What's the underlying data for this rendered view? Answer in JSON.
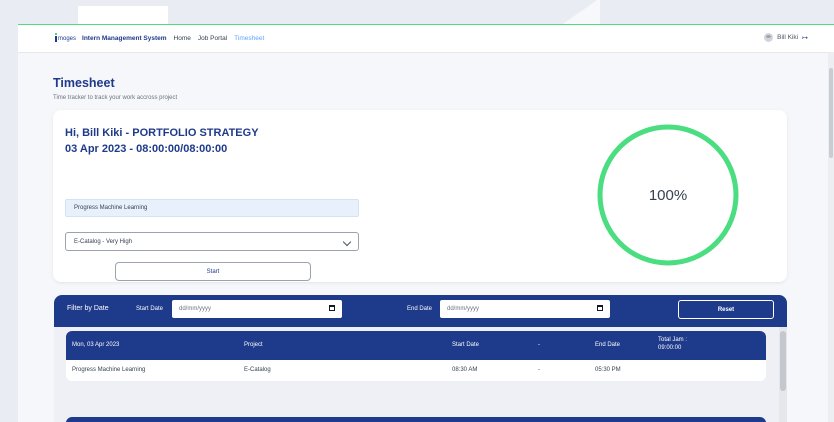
{
  "colors": {
    "brand": "#1e3a8a",
    "accent": "#60a5fa",
    "progress": "#4ade80"
  },
  "navbar": {
    "logo_text": "moges",
    "app_title": "Intern Management System",
    "links": [
      "Home",
      "Job Portal",
      "Timesheet"
    ],
    "active_link": "Timesheet",
    "user_name": "Bill Kiki",
    "logout_icon": "logout-icon"
  },
  "page": {
    "title": "Timesheet",
    "subtitle": "Time tracker to track your work accross project"
  },
  "tracker": {
    "greeting": "Hi, Bill Kiki - PORTFOLIO STRATEGY",
    "date_time": "03 Apr 2023 - 08:00:00/08:00:00",
    "task_value": "Progress Machine Learning",
    "project_selected": "E-Catalog - Very High",
    "start_label": "Start",
    "progress_percent": 100,
    "progress_label": "100%"
  },
  "filter": {
    "title": "Filter by Date",
    "start_label": "Start Date",
    "start_placeholder": "dd/mm/yyyy",
    "end_label": "End Date",
    "end_placeholder": "dd/mm/yyyy",
    "reset_label": "Reset"
  },
  "table": {
    "date_header": "Mon, 03 Apr 2023",
    "project_header": "Project",
    "start_header": "Start Date",
    "sep": "-",
    "end_header": "End Date",
    "total_label": "Total Jam :",
    "total_value": "09:00:00",
    "rows": [
      {
        "task": "Progress Machine Learning",
        "project": "E-Catalog",
        "start": "08:30 AM",
        "sep": "-",
        "end": "05:30 PM"
      }
    ]
  }
}
